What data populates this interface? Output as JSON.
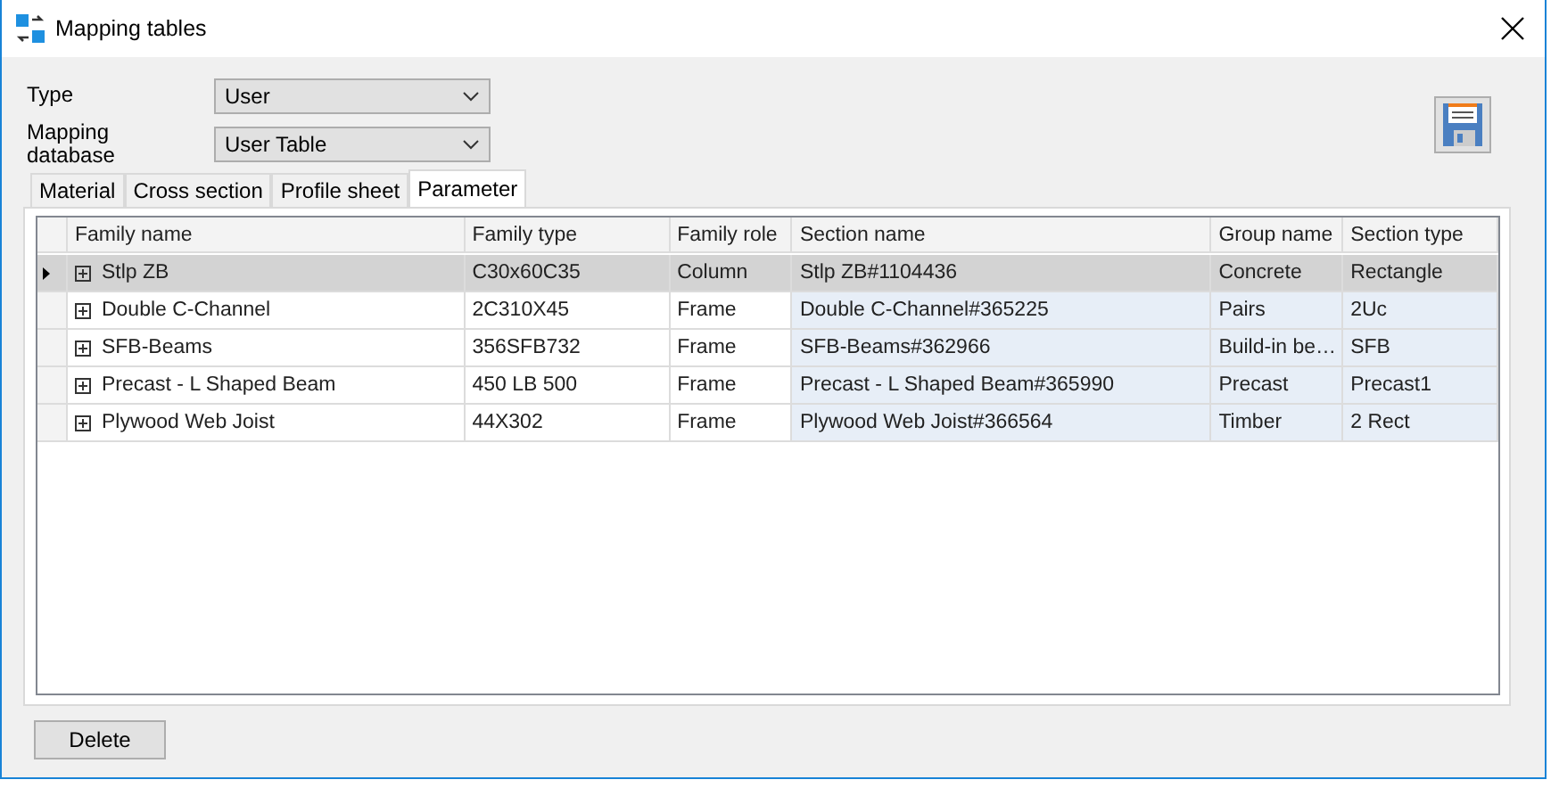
{
  "window": {
    "title": "Mapping tables"
  },
  "fields": [
    {
      "label": "Type",
      "value": "User"
    },
    {
      "label": "Mapping database",
      "value": "User Table"
    }
  ],
  "tabs": [
    {
      "label": "Material",
      "selected": false
    },
    {
      "label": "Cross section",
      "selected": false
    },
    {
      "label": "Profile sheet",
      "selected": false
    },
    {
      "label": "Parameter",
      "selected": true
    }
  ],
  "table": {
    "columns": [
      "Family name",
      "Family type",
      "Family role",
      "Section name",
      "Group name",
      "Section type"
    ],
    "rows": [
      {
        "selected": true,
        "expanded": false,
        "cells": [
          "Stlp ZB",
          "C30x60C35",
          "Column",
          "Stlp ZB#1104436",
          "Concrete",
          "Rectangle"
        ]
      },
      {
        "selected": false,
        "expanded": false,
        "cells": [
          "Double C-Channel",
          "2C310X45",
          "Frame",
          "Double C-Channel#365225",
          "Pairs",
          "2Uc"
        ]
      },
      {
        "selected": false,
        "expanded": false,
        "cells": [
          "SFB-Beams",
          "356SFB732",
          "Frame",
          "SFB-Beams#362966",
          "Build-in be…",
          "SFB"
        ]
      },
      {
        "selected": false,
        "expanded": false,
        "cells": [
          "Precast - L Shaped Beam",
          "450 LB 500",
          "Frame",
          "Precast - L Shaped Beam#365990",
          "Precast",
          "Precast1"
        ]
      },
      {
        "selected": false,
        "expanded": false,
        "cells": [
          "Plywood Web Joist",
          "44X302",
          "Frame",
          "Plywood Web Joist#366564",
          "Timber",
          "2 Rect"
        ]
      }
    ]
  },
  "buttons": [
    "Delete"
  ]
}
